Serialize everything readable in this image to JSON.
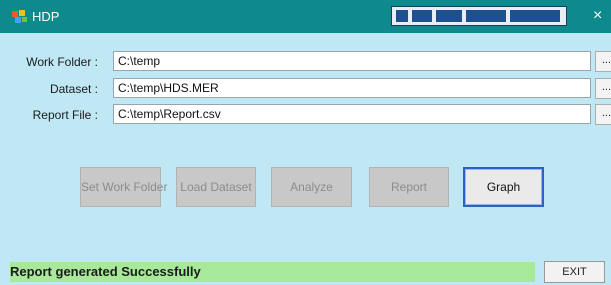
{
  "window": {
    "title": "HDP",
    "icon": "app-icon",
    "close_glyph": "×"
  },
  "form": {
    "work_folder": {
      "label": "Work Folder :",
      "value": "C:\\temp",
      "browse_label": "...."
    },
    "dataset": {
      "label": "Dataset :",
      "value": "C:\\temp\\HDS.MER",
      "browse_label": "...."
    },
    "report_file": {
      "label": "Report File :",
      "value": "C:\\temp\\Report.csv",
      "browse_label": "...."
    }
  },
  "actions": {
    "set_work_folder": "Set Work Folder",
    "load_dataset": "Load Dataset",
    "analyze": "Analyze",
    "report": "Report",
    "graph": "Graph"
  },
  "status": {
    "message": "Report generated Successfully",
    "color": "#a8e89a"
  },
  "exit_label": "EXIT",
  "colors": {
    "titlebar": "#0e8a8c",
    "background": "#bfe8f4",
    "focus_border": "#2c62c6"
  }
}
